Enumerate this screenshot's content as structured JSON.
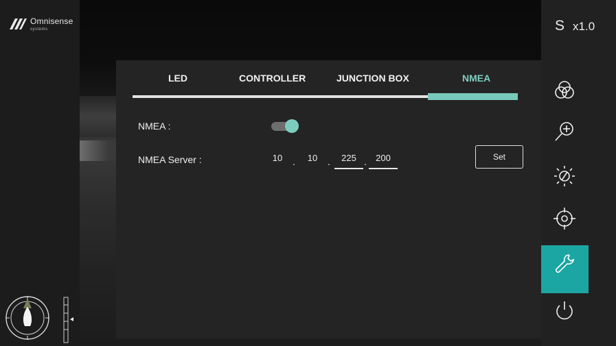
{
  "brand": {
    "name": "Omnisense",
    "sub": "systems"
  },
  "zoom": {
    "mode": "S",
    "level": "x1.0"
  },
  "tabs": [
    {
      "label": "LED"
    },
    {
      "label": "CONTROLLER"
    },
    {
      "label": "JUNCTION BOX"
    },
    {
      "label": "NMEA",
      "active": true
    }
  ],
  "nmea": {
    "toggle_label": "NMEA :",
    "enabled": true,
    "server_label": "NMEA Server :",
    "ip": [
      "10",
      "10",
      "225",
      "200"
    ],
    "set_label": "Set"
  },
  "sidebar": [
    {
      "icon": "color-filters-icon"
    },
    {
      "icon": "zoom-in-icon"
    },
    {
      "icon": "brightness-icon"
    },
    {
      "icon": "target-icon"
    },
    {
      "icon": "wrench-icon",
      "active": true
    },
    {
      "icon": "power-icon"
    }
  ],
  "colors": {
    "accent": "#79c9bd",
    "active_tile": "#1ba6a3",
    "panel": "#242424"
  }
}
